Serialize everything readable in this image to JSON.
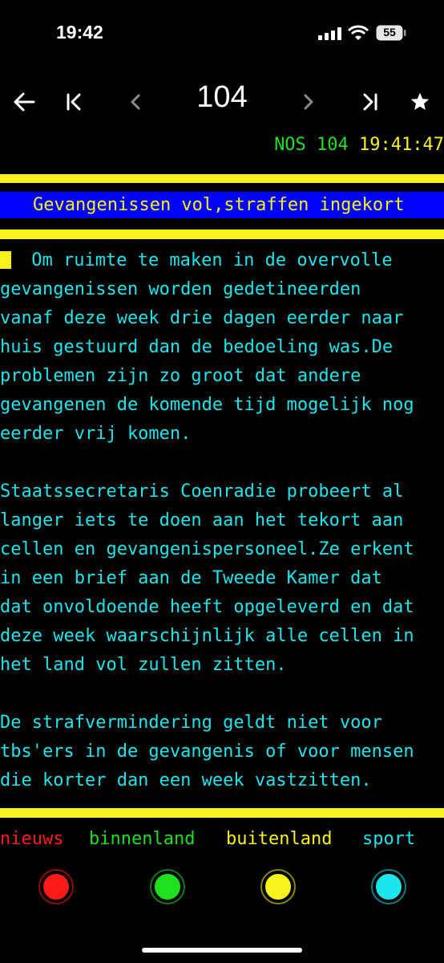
{
  "status": {
    "time": "19:42",
    "battery": "55"
  },
  "nav": {
    "page": "104",
    "back_icon": "arrow-left-icon",
    "first_icon": "first-page-icon",
    "prev_icon": "chevron-left-icon",
    "next_icon": "chevron-right-icon",
    "last_icon": "last-page-icon",
    "favorite_icon": "star-icon"
  },
  "teletext": {
    "header_source": "NOS 104",
    "header_clock": "19:41:47",
    "headline": "Gevangenissen vol,straffen ingekort",
    "lines": [
      " Om ruimte te maken in de overvolle",
      "gevangenissen worden gedetineerden",
      "vanaf deze week drie dagen eerder naar",
      "huis gestuurd dan de bedoeling was.De",
      "problemen zijn zo groot dat andere",
      "gevangenen de komende tijd mogelijk nog",
      "eerder vrij komen.",
      "",
      "Staatssecretaris Coenradie probeert al",
      "langer iets te doen aan het tekort aan",
      "cellen en gevangenispersoneel.Ze erkent",
      "in een brief aan de Tweede Kamer dat",
      "dat onvoldoende heeft opgeleverd en dat",
      "deze week waarschijnlijk alle cellen in",
      "het land vol zullen zitten.",
      "",
      "De strafvermindering geldt niet voor",
      "tbs'ers in de gevangenis of voor mensen",
      "die korter dan een week vastzitten."
    ],
    "fastext": [
      {
        "label": "nieuws",
        "color": "#ff1a1a"
      },
      {
        "label": "binnenland",
        "color": "#1fe01f"
      },
      {
        "label": "buitenland",
        "color": "#f7f21b"
      },
      {
        "label": "sport",
        "color": "#1ce6ec"
      }
    ]
  },
  "colors": {
    "yellow": "#f7f21b",
    "blue": "#0000ff",
    "cyan": "#1ce6ec",
    "green": "#1fe01f",
    "red": "#ff1a1a"
  }
}
